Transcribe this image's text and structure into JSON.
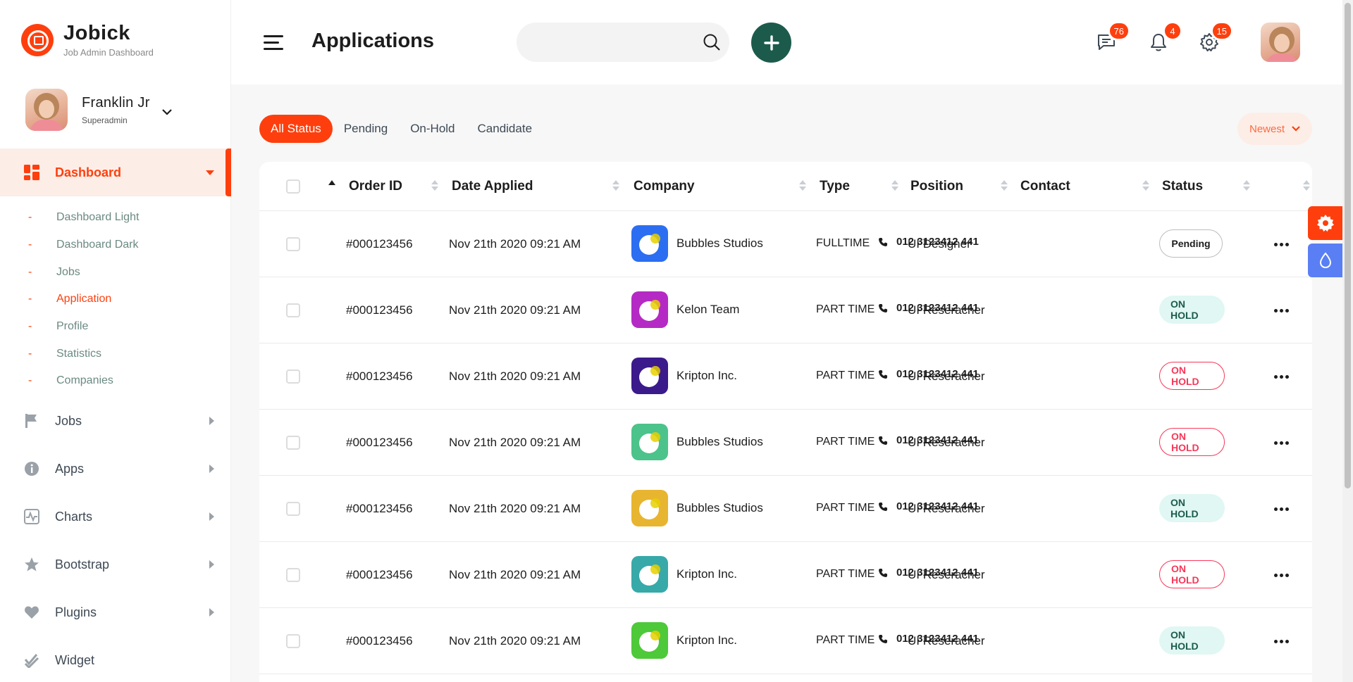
{
  "brand": {
    "name": "Jobick",
    "subtitle": "Job Admin Dashboard"
  },
  "user": {
    "name": "Franklin Jr",
    "role": "Superadmin"
  },
  "sidebar": {
    "active": {
      "label": "Dashboard"
    },
    "sub_items": [
      "Dashboard Light",
      "Dashboard Dark",
      "Jobs",
      "Application",
      "Profile",
      "Statistics",
      "Companies"
    ],
    "items": [
      {
        "label": "Jobs",
        "icon": "flag-icon"
      },
      {
        "label": "Apps",
        "icon": "info-icon"
      },
      {
        "label": "Charts",
        "icon": "chart-icon"
      },
      {
        "label": "Bootstrap",
        "icon": "star-icon"
      },
      {
        "label": "Plugins",
        "icon": "heart-icon"
      },
      {
        "label": "Widget",
        "icon": "widget-icon"
      }
    ]
  },
  "header": {
    "title": "Applications",
    "search_placeholder": "",
    "badges": {
      "messages": "76",
      "notifications": "4",
      "settings": "15"
    }
  },
  "filters": {
    "tabs": [
      "All Status",
      "Pending",
      "On-Hold",
      "Candidate"
    ],
    "active": "All Status",
    "sort_label": "Newest"
  },
  "table": {
    "columns": [
      "Order ID",
      "Date Applied",
      "Company",
      "Type",
      "Position",
      "Contact",
      "Status"
    ],
    "rows": [
      {
        "order_id": "#000123456",
        "date": "Nov 21th 2020 09:21 AM",
        "company": "Bubbles Studios",
        "logo_color": "#2c6ef2",
        "type": "FULLTIME",
        "position": "UI Designer",
        "contact": "012 3123412 441",
        "status": "Pending",
        "status_style": "pending"
      },
      {
        "order_id": "#000123456",
        "date": "Nov 21th 2020 09:21 AM",
        "company": "Kelon Team",
        "logo_color": "#b52ac4",
        "type": "PART TIME",
        "position": "UI Reseracher",
        "contact": "012 3123412 441",
        "status": "ON HOLD",
        "status_style": "hold-green"
      },
      {
        "order_id": "#000123456",
        "date": "Nov 21th 2020 09:21 AM",
        "company": "Kripton Inc.",
        "logo_color": "#3b1a8c",
        "type": "PART TIME",
        "position": "UI Reseracher",
        "contact": "012 3123412 441",
        "status": "ON HOLD",
        "status_style": "hold-red"
      },
      {
        "order_id": "#000123456",
        "date": "Nov 21th 2020 09:21 AM",
        "company": "Bubbles Studios",
        "logo_color": "#4cc38a",
        "type": "PART TIME",
        "position": "UI Reseracher",
        "contact": "012 3123412 441",
        "status": "ON HOLD",
        "status_style": "hold-red"
      },
      {
        "order_id": "#000123456",
        "date": "Nov 21th 2020 09:21 AM",
        "company": "Bubbles Studios",
        "logo_color": "#e8b530",
        "type": "PART TIME",
        "position": "UI Reseracher",
        "contact": "012 3123412 441",
        "status": "ON HOLD",
        "status_style": "hold-green"
      },
      {
        "order_id": "#000123456",
        "date": "Nov 21th 2020 09:21 AM",
        "company": "Kripton Inc.",
        "logo_color": "#37a9a9",
        "type": "PART TIME",
        "position": "UI Reseracher",
        "contact": "012 3123412 441",
        "status": "ON HOLD",
        "status_style": "hold-red"
      },
      {
        "order_id": "#000123456",
        "date": "Nov 21th 2020 09:21 AM",
        "company": "Kripton Inc.",
        "logo_color": "#4dc93a",
        "type": "PART TIME",
        "position": "UI Reseracher",
        "contact": "012 3123412 441",
        "status": "ON HOLD",
        "status_style": "hold-green"
      }
    ]
  },
  "colors": {
    "accent": "#fe3f0d",
    "primary_dark": "#1c5b4c",
    "danger": "#f73759",
    "side_tool_blue": "#5a7ff5"
  }
}
